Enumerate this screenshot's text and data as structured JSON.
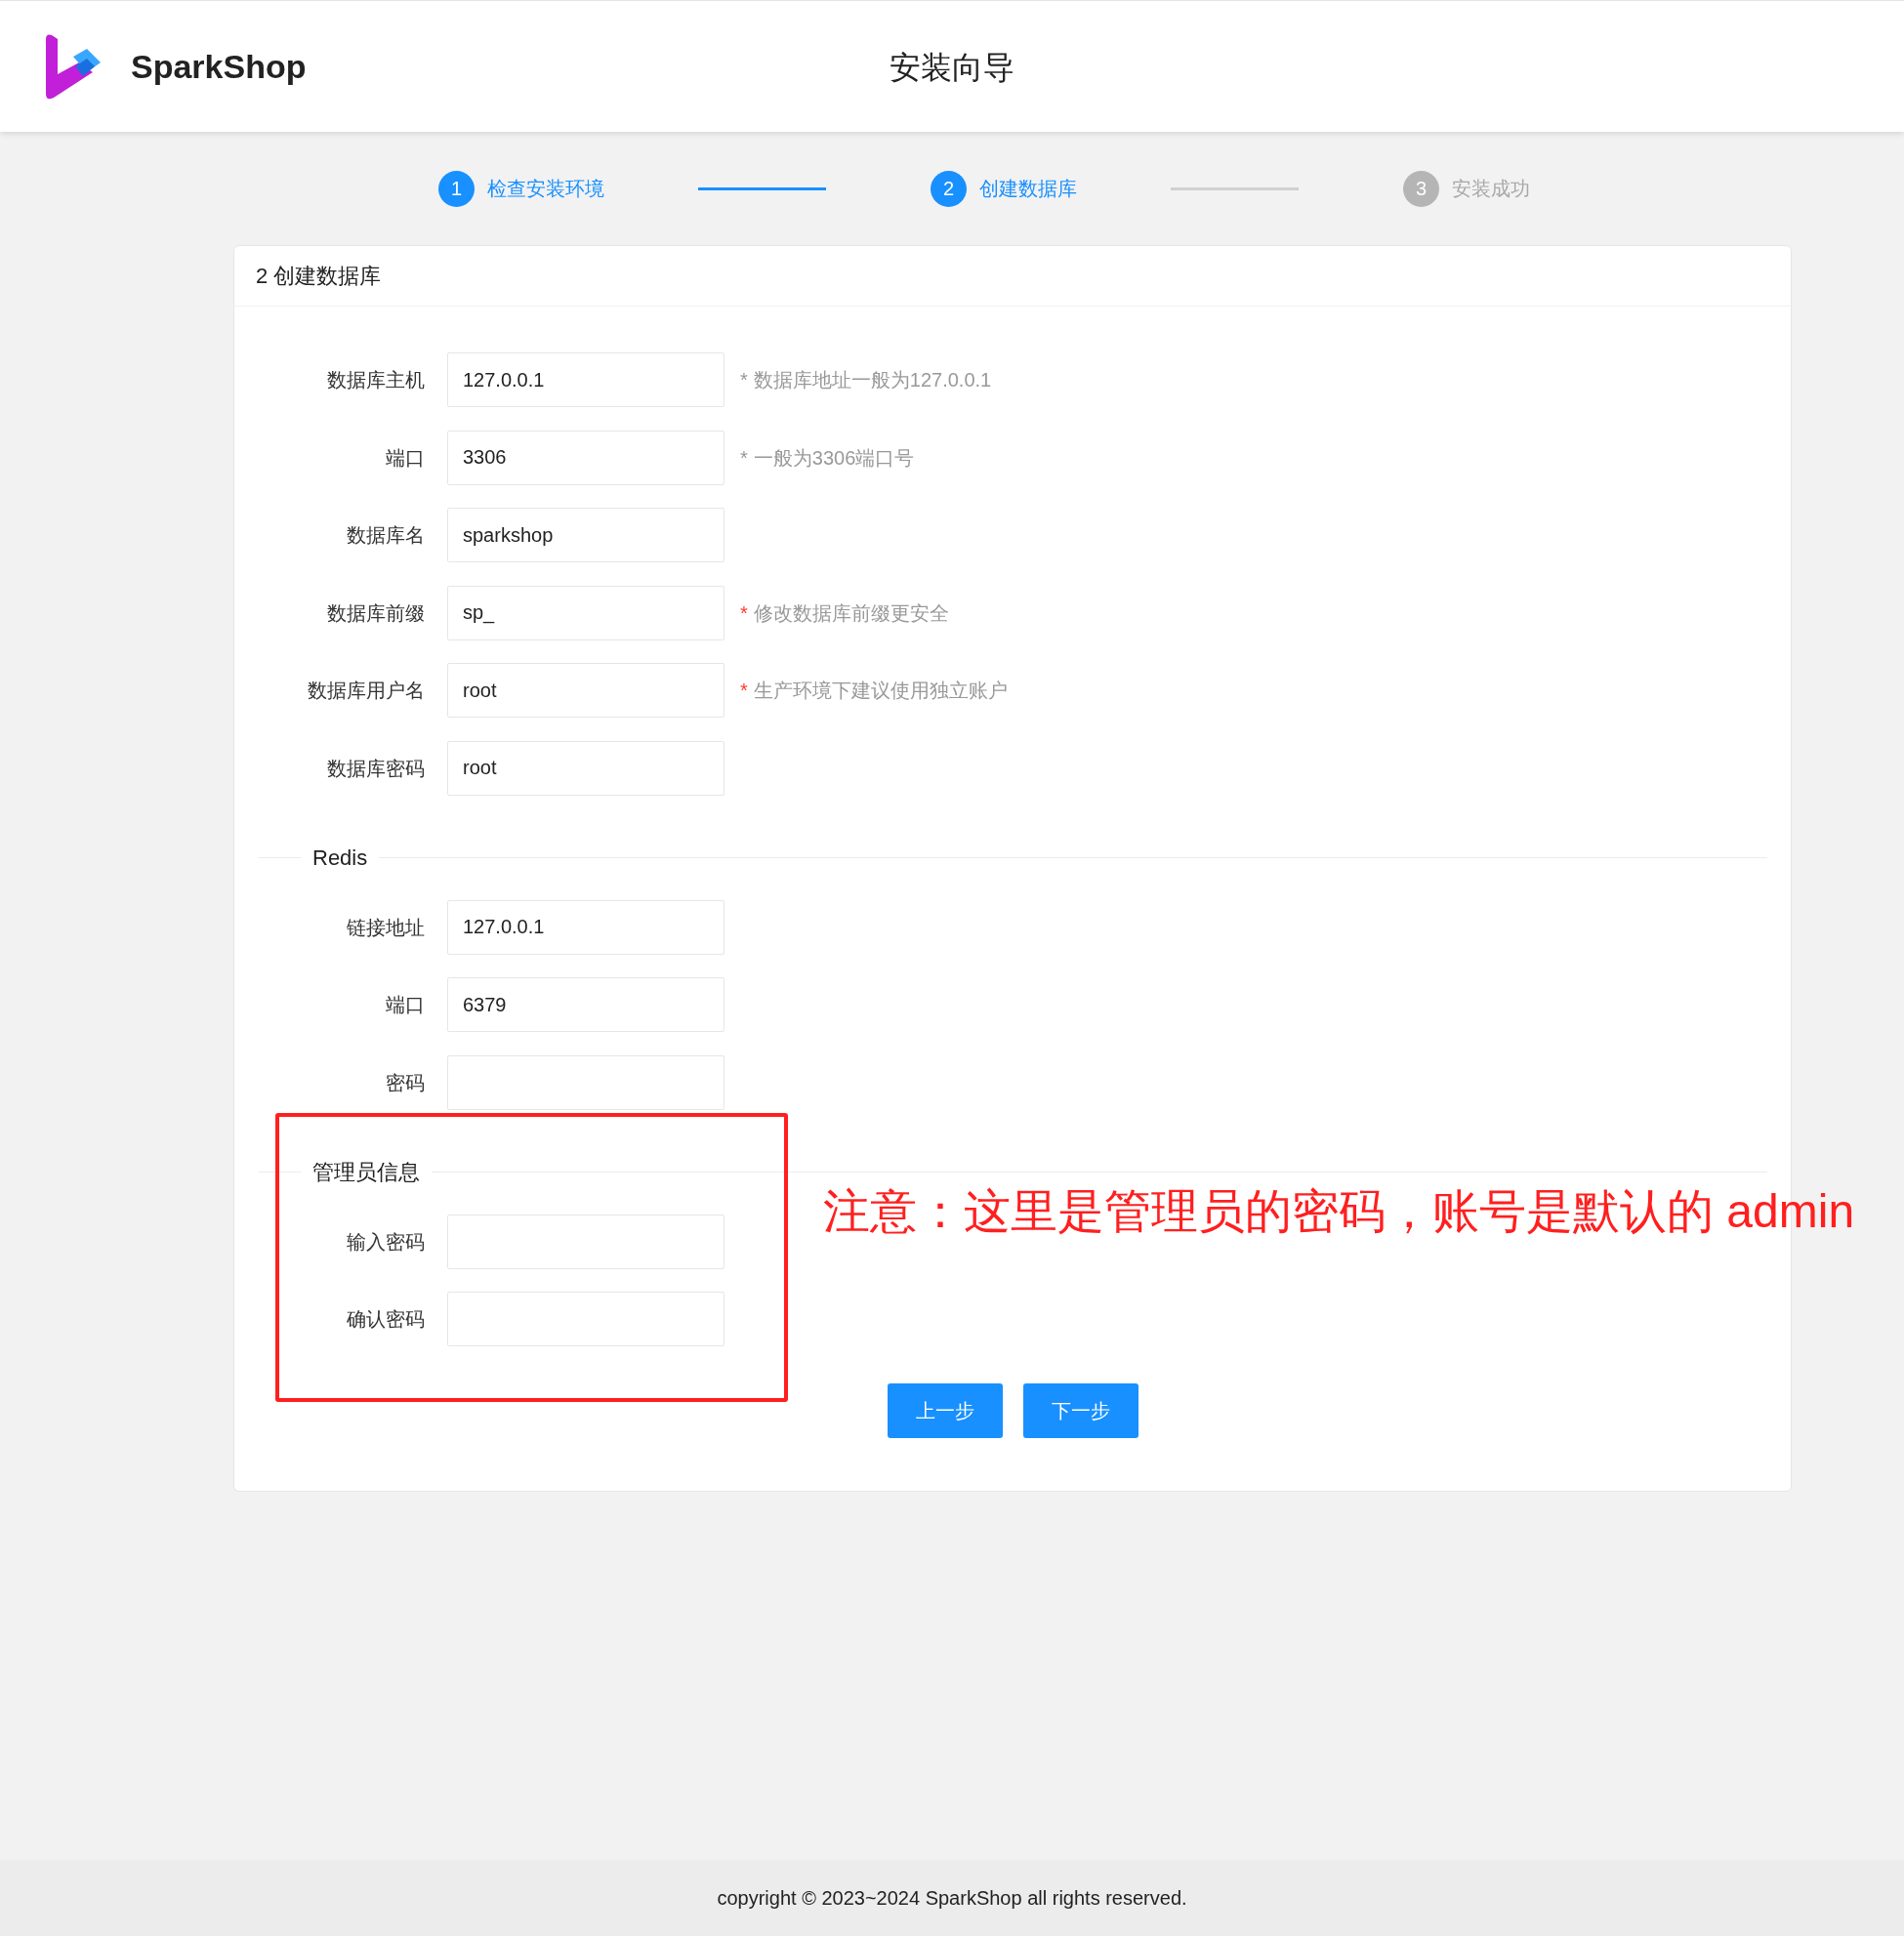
{
  "header": {
    "brand": "SparkShop",
    "title": "安装向导"
  },
  "steps": [
    {
      "number": "1",
      "label": "检查安装环境",
      "reached": true
    },
    {
      "number": "2",
      "label": "创建数据库",
      "reached": true
    },
    {
      "number": "3",
      "label": "安装成功",
      "reached": false
    }
  ],
  "card": {
    "title": "2 创建数据库"
  },
  "sections": [
    {
      "fields": [
        {
          "label": "数据库主机",
          "value": "127.0.0.1",
          "hint": {
            "mark": "*",
            "red": false,
            "text": "数据库地址一般为127.0.0.1"
          }
        },
        {
          "label": "端口",
          "value": "3306",
          "hint": {
            "mark": "*",
            "red": false,
            "text": "一般为3306端口号"
          }
        },
        {
          "label": "数据库名",
          "value": "sparkshop"
        },
        {
          "label": "数据库前缀",
          "value": "sp_",
          "hint": {
            "mark": "*",
            "red": true,
            "text": "修改数据库前缀更安全"
          }
        },
        {
          "label": "数据库用户名",
          "value": "root",
          "hint": {
            "mark": "*",
            "red": true,
            "text": "生产环境下建议使用独立账户"
          }
        },
        {
          "label": "数据库密码",
          "value": "root"
        }
      ]
    },
    {
      "heading": "Redis",
      "fields": [
        {
          "label": "链接地址",
          "value": "127.0.0.1"
        },
        {
          "label": "端口",
          "value": "6379"
        },
        {
          "label": "密码"
        }
      ]
    },
    {
      "heading": "管理员信息",
      "fields": [
        {
          "label": "输入密码"
        },
        {
          "label": "确认密码"
        }
      ]
    }
  ],
  "buttons": [
    "上一步",
    "下一步"
  ],
  "annotation": "注意：这里是管理员的密码，账号是默认的 admin",
  "footer": "copyright © 2023~2024 SparkShop all rights reserved."
}
